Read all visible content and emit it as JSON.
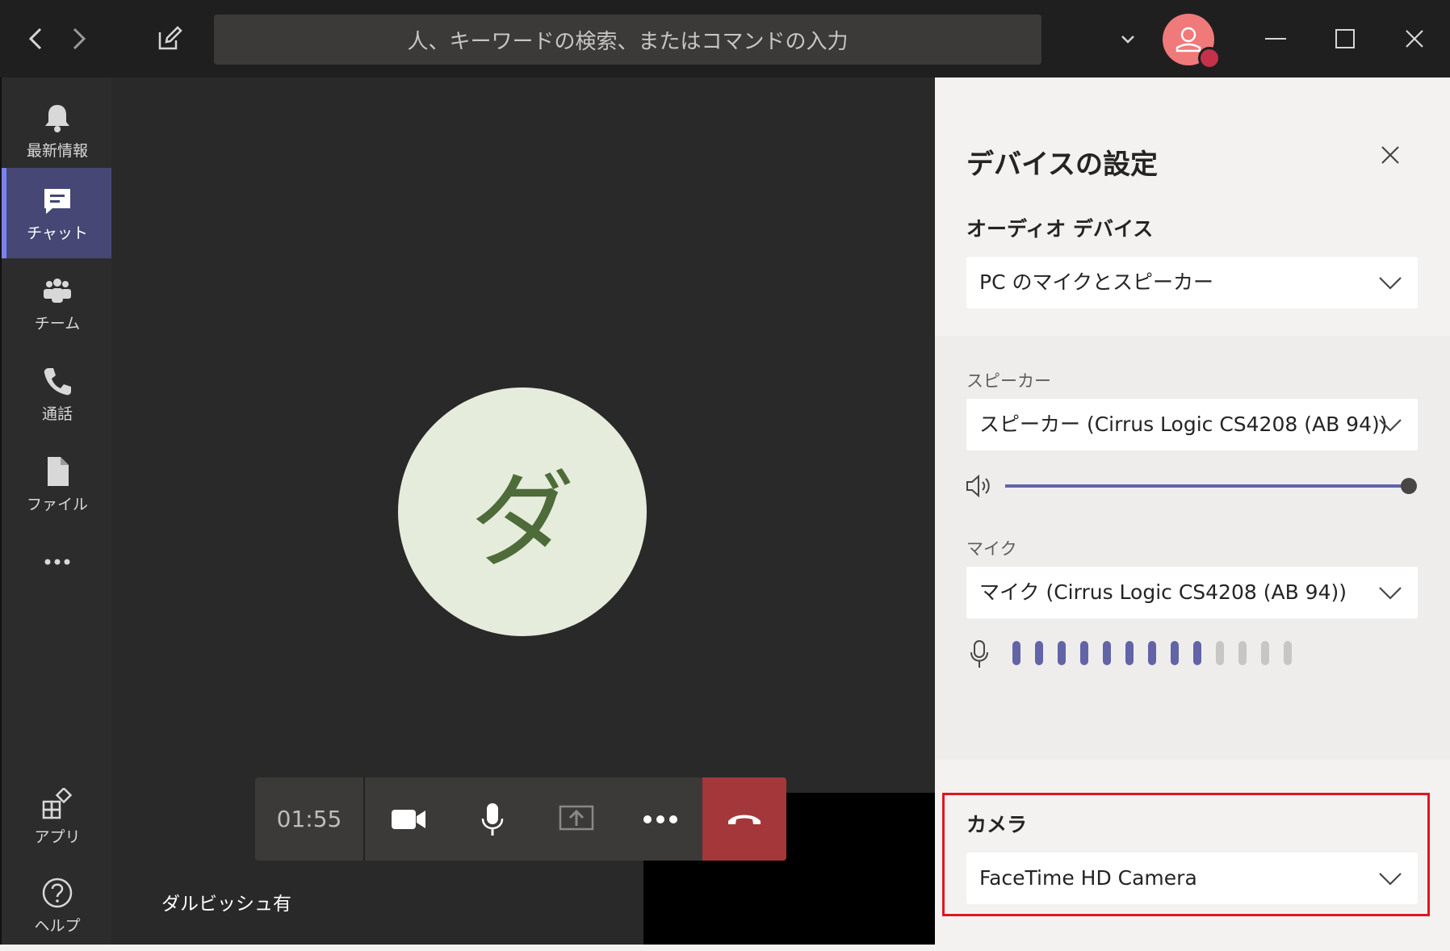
{
  "titlebar": {
    "search_placeholder": "人、キーワードの検索、またはコマンドの入力",
    "icons": [
      "back-arrow-icon",
      "forward-arrow-icon",
      "compose-icon",
      "chevron-down-icon",
      "minimize-icon",
      "maximize-icon",
      "close-icon"
    ]
  },
  "rail": {
    "items": [
      {
        "label": "最新情報",
        "icon": "bell-icon"
      },
      {
        "label": "チャット",
        "icon": "chat-icon",
        "active": true
      },
      {
        "label": "チーム",
        "icon": "teams-icon"
      },
      {
        "label": "通話",
        "icon": "phone-icon"
      },
      {
        "label": "ファイル",
        "icon": "file-icon"
      },
      {
        "label": "…",
        "icon": "more-icon"
      },
      {
        "label": "アプリ",
        "icon": "apps-icon"
      },
      {
        "label": "ヘルプ",
        "icon": "help-icon"
      }
    ]
  },
  "stage": {
    "avatar_initial": "ダ",
    "caller_name": "ダルビッシュ有",
    "call_timer": "01:55"
  },
  "panel": {
    "title": "デバイスの設定",
    "audio_section": "オーディオ デバイス",
    "audio_device": "PC のマイクとスピーカー",
    "speaker_label": "スピーカー",
    "speaker_device": "スピーカー (Cirrus Logic CS4208 (AB 94))",
    "speaker_volume_pct": 100,
    "mic_label": "マイク",
    "mic_device": "マイク (Cirrus Logic CS4208 (AB 94))",
    "mic_level_bars_active": 9,
    "mic_level_bars_total": 13,
    "camera_section": "カメラ",
    "camera_device": "FaceTime HD Camera"
  },
  "colors": {
    "accent": "#6264a7",
    "hangup": "#a4373a",
    "highlight_box": "#e0161e",
    "avatar_bg": "#e5ecdc"
  }
}
